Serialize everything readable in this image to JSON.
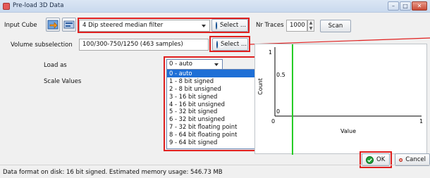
{
  "window": {
    "title": "Pre-load 3D Data",
    "minimize": "–",
    "maximize": "□",
    "close": "✕"
  },
  "input_cube": {
    "label": "Input Cube",
    "value": "4 Dip steered median filter",
    "select_label": "Select ..."
  },
  "nr_traces": {
    "label": "Nr Traces",
    "value": "1000",
    "up": "▲",
    "down": "▼"
  },
  "scan_label": "Scan",
  "volume": {
    "label": "Volume subselection",
    "value": "100/300-750/1250 (463 samples)",
    "select_label": "Select ..."
  },
  "load_as": {
    "label": "Load as",
    "value": "0 - auto"
  },
  "scale_values": {
    "label": "Scale Values"
  },
  "load_options": [
    "0 - auto",
    "1 - 8  bit signed",
    "2 - 8  bit unsigned",
    "3 - 16 bit signed",
    "4 - 16 bit unsigned",
    "5 - 32 bit signed",
    "6 - 32 bit unsigned",
    "7 - 32 bit floating point",
    "8 - 64 bit floating point",
    "9 - 64 bit signed"
  ],
  "load_selected_index": 0,
  "histogram": {
    "y_label": "Count",
    "x_label": "Value",
    "y_top": "1",
    "y_mid": "0.5",
    "y_bottom": "0",
    "x_left": "0",
    "x_right": "1",
    "marker_value": 0.12,
    "colors": {
      "marker": "#22cc22",
      "axis": "#000000"
    }
  },
  "ok_label": "OK",
  "cancel_label": "Cancel",
  "status": "Data format on disk: 16 bit signed. Estimated memory usage: 546.73 MB",
  "colors": {
    "highlight": "#e0201f",
    "selection": "#1e6fd6"
  }
}
